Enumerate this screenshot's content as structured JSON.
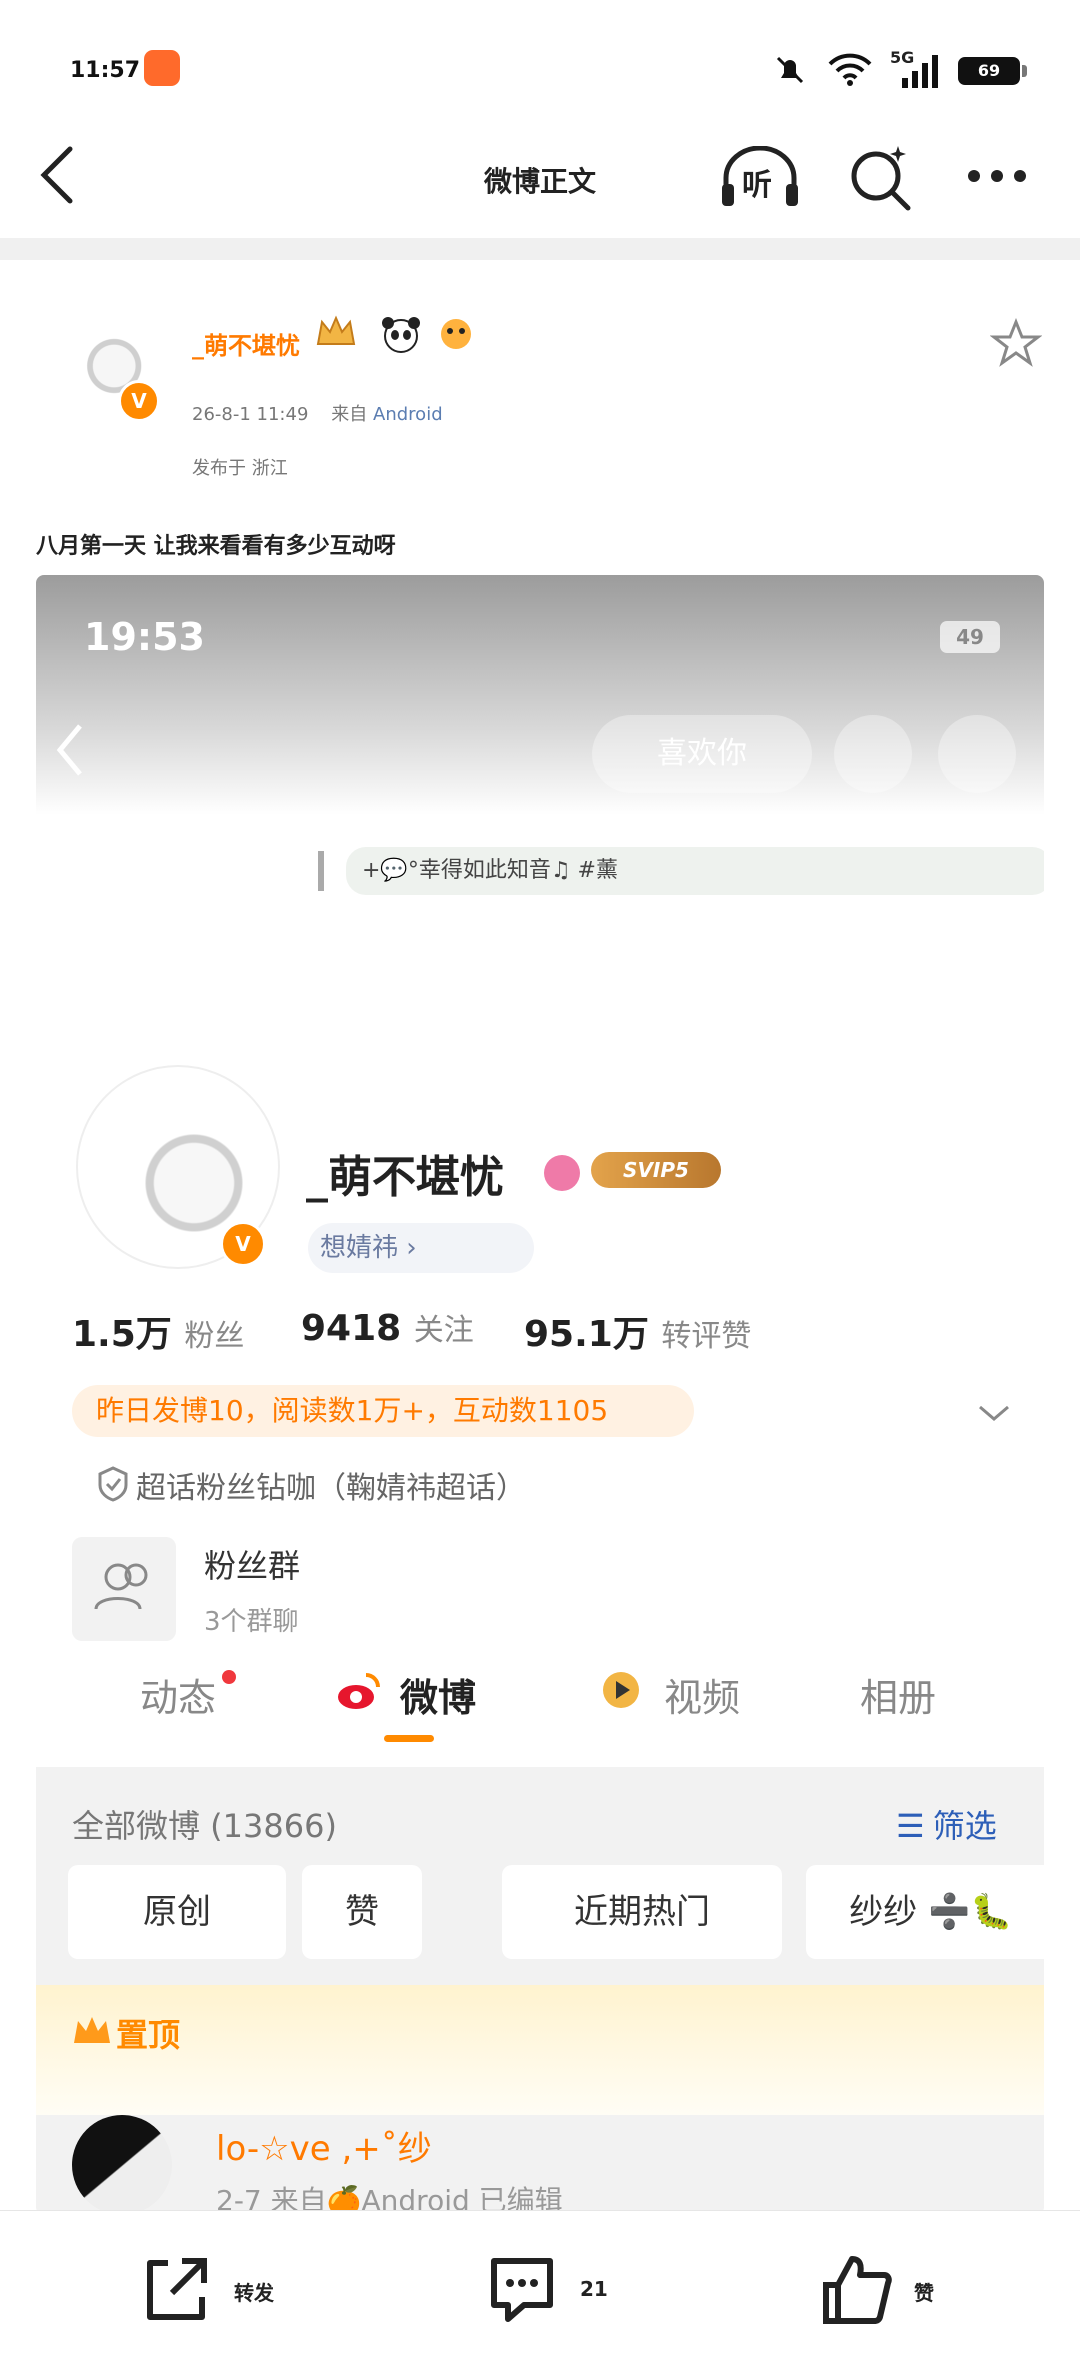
{
  "status_bar": {
    "time": "11:57",
    "network": "5G",
    "battery": "69"
  },
  "nav": {
    "title": "微博正文",
    "listen_label": "听"
  },
  "post": {
    "username": "_萌不堪忧",
    "timestamp": "26-8-1 11:49",
    "source_prefix": "来自",
    "source": "Android",
    "location": "发布于 浙江",
    "text": "八月第一天 让我来看看有多少互动呀",
    "verified_badge": "V"
  },
  "post_image": {
    "status_time": "19:53",
    "battery": "49",
    "like_button": "喜欢你",
    "status_text": "+💬°幸得如此知音♫ #薰",
    "profile_name": "_萌不堪忧",
    "svip": "SVIP5",
    "tag_chip": "想婧祎 ›",
    "stats": [
      {
        "value": "1.5万",
        "label": "粉丝"
      },
      {
        "value": "9418",
        "label": "关注"
      },
      {
        "value": "95.1万",
        "label": "转评赞"
      }
    ],
    "activity_line": "昨日发博10，阅读数1万+，互动数1105",
    "fan_title": "超话粉丝钻咖（鞠婧祎超话）",
    "fan_group_title": "粉丝群",
    "fan_group_sub": "3个群聊",
    "tabs": [
      "动态",
      "微博",
      "视频",
      "相册"
    ],
    "all_weibo": "全部微博 (13866)",
    "filter": "筛选",
    "chips": [
      "原创",
      "赞",
      "近期热门",
      "纱纱 ➗🐛"
    ],
    "pinned": "置顶",
    "pinned_post_name": "lo-☆ve ,+˚纱",
    "pinned_post_meta": "2-7 来自🍊Android 已编辑"
  },
  "bottom_bar": {
    "repost_label": "转发",
    "comment_count": "21",
    "like_label": "赞"
  },
  "colors": {
    "accent": "#ff8a00",
    "link": "#2d5fb8"
  }
}
